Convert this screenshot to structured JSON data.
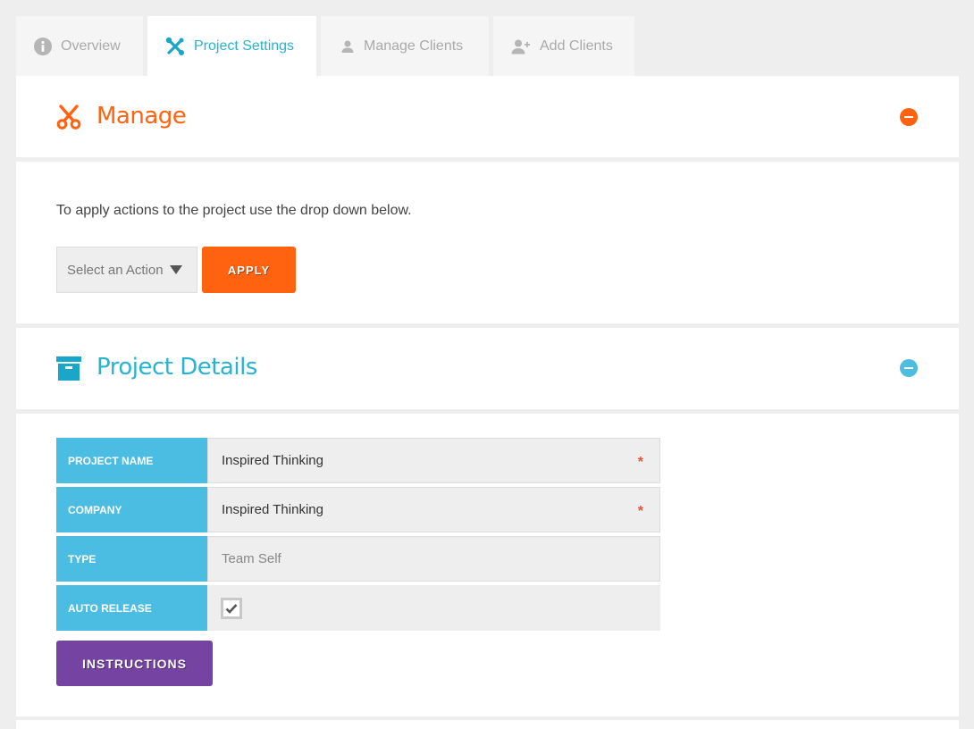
{
  "tabs": [
    {
      "label": "Overview",
      "icon": "info-icon",
      "active": false
    },
    {
      "label": "Project Settings",
      "icon": "tools-icon",
      "active": true
    },
    {
      "label": "Manage Clients",
      "icon": "user-icon",
      "active": false
    },
    {
      "label": "Add Clients",
      "icon": "user-plus-icon",
      "active": false
    }
  ],
  "manage": {
    "title": "Manage",
    "icon": "scissors-icon",
    "intro": "To apply actions to the project use the drop down below.",
    "select_value": "Select an Action",
    "apply_label": "APPLY"
  },
  "details": {
    "title": "Project Details",
    "icon": "archive-box-icon",
    "fields": [
      {
        "label": "PROJECT NAME",
        "value": "Inspired Thinking",
        "required": true
      },
      {
        "label": "COMPANY",
        "value": "Inspired Thinking",
        "required": true
      },
      {
        "label": "TYPE",
        "value": "Team Self",
        "required": false
      },
      {
        "label": "AUTO RELEASE",
        "checked": true
      }
    ],
    "required_mark": "*",
    "instructions_label": "INSTRUCTIONS"
  },
  "colors": {
    "accent_orange": "#ff6310",
    "accent_blue": "#29b3d1",
    "label_blue": "#4cbde2",
    "purple": "#7544a3"
  }
}
